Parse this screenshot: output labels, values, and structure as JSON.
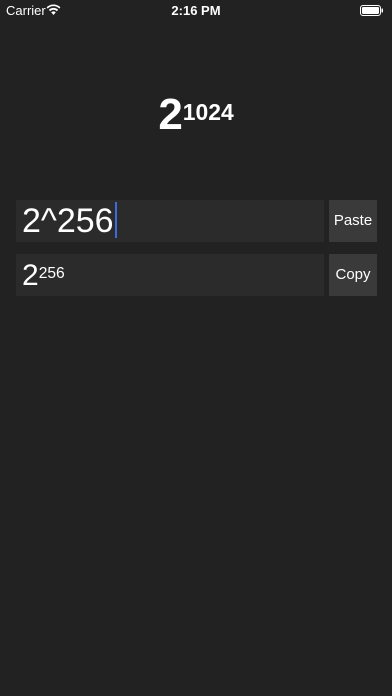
{
  "status_bar": {
    "carrier": "Carrier",
    "time": "2:16 PM",
    "wifi_icon": "wifi-icon",
    "battery_icon": "battery-icon"
  },
  "header": {
    "base": "2",
    "exponent": "1024"
  },
  "input": {
    "value": "2^256",
    "paste_label": "Paste"
  },
  "result": {
    "base": "2",
    "exponent": "256",
    "copy_label": "Copy"
  },
  "colors": {
    "background": "#222222",
    "field": "#2b2b2b",
    "button": "#3a3a3a",
    "caret": "#3b6bdc"
  }
}
